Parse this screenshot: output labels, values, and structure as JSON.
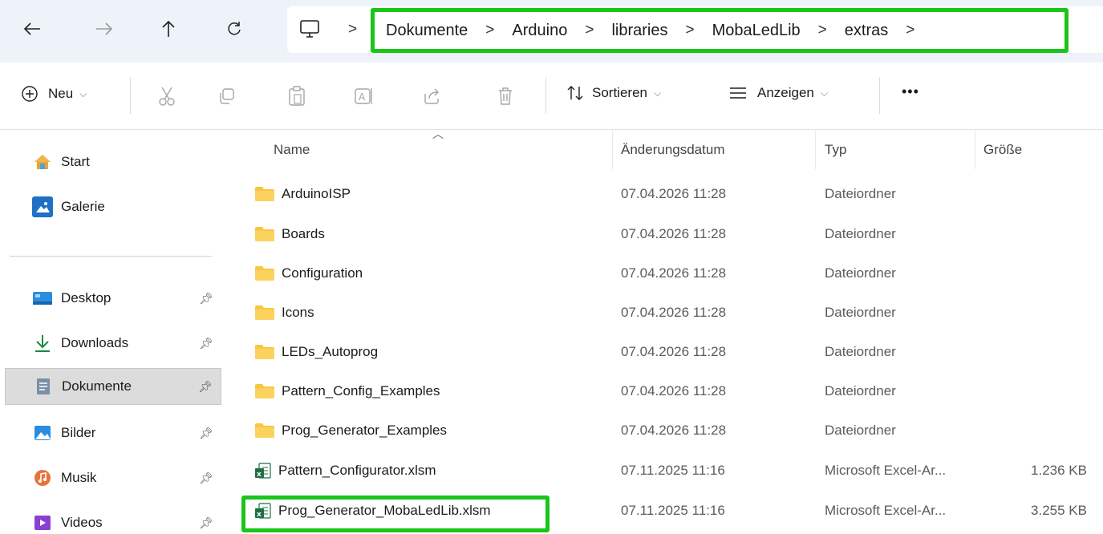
{
  "breadcrumb": {
    "items": [
      "Dokumente",
      "Arduino",
      "libraries",
      "MobaLedLib",
      "extras"
    ],
    "separator": ">"
  },
  "commands": {
    "new_label": "Neu",
    "sort_label": "Sortieren",
    "view_label": "Anzeigen",
    "more_label": "•••"
  },
  "sidebar": {
    "items": [
      {
        "label": "Start",
        "icon": "home-icon"
      },
      {
        "label": "Galerie",
        "icon": "gallery-icon"
      },
      {
        "label": "Desktop",
        "icon": "desktop-icon"
      },
      {
        "label": "Downloads",
        "icon": "download-icon"
      },
      {
        "label": "Dokumente",
        "icon": "documents-icon"
      },
      {
        "label": "Bilder",
        "icon": "pictures-icon"
      },
      {
        "label": "Musik",
        "icon": "music-icon"
      },
      {
        "label": "Videos",
        "icon": "videos-icon"
      }
    ]
  },
  "columns": {
    "name": "Name",
    "date": "Änderungsdatum",
    "type": "Typ",
    "size": "Größe"
  },
  "files": [
    {
      "name": "ArduinoISP",
      "date": "07.04.2026 11:28",
      "type": "Dateiordner",
      "size": "",
      "kind": "folder"
    },
    {
      "name": "Boards",
      "date": "07.04.2026 11:28",
      "type": "Dateiordner",
      "size": "",
      "kind": "folder"
    },
    {
      "name": "Configuration",
      "date": "07.04.2026 11:28",
      "type": "Dateiordner",
      "size": "",
      "kind": "folder"
    },
    {
      "name": "Icons",
      "date": "07.04.2026 11:28",
      "type": "Dateiordner",
      "size": "",
      "kind": "folder"
    },
    {
      "name": "LEDs_Autoprog",
      "date": "07.04.2026 11:28",
      "type": "Dateiordner",
      "size": "",
      "kind": "folder"
    },
    {
      "name": "Pattern_Config_Examples",
      "date": "07.04.2026 11:28",
      "type": "Dateiordner",
      "size": "",
      "kind": "folder"
    },
    {
      "name": "Prog_Generator_Examples",
      "date": "07.04.2026 11:28",
      "type": "Dateiordner",
      "size": "",
      "kind": "folder"
    },
    {
      "name": "Pattern_Configurator.xlsm",
      "date": "07.11.2025 11:16",
      "type": "Microsoft Excel-Ar...",
      "size": "1.236 KB",
      "kind": "excel"
    },
    {
      "name": "Prog_Generator_MobaLedLib.xlsm",
      "date": "07.11.2025 11:16",
      "type": "Microsoft Excel-Ar...",
      "size": "3.255 KB",
      "kind": "excel"
    }
  ],
  "colors": {
    "highlight": "#19c51a",
    "folder": "#f8c640",
    "excel": "#1d6f42"
  }
}
